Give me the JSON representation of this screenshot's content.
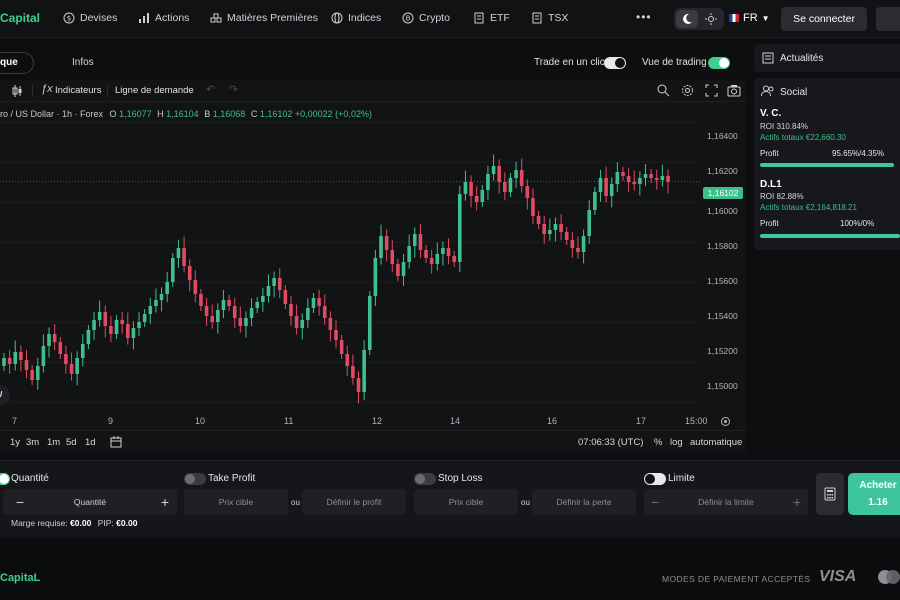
{
  "brand": {
    "name": "Capital"
  },
  "nav": {
    "items": [
      "Devises",
      "Actions",
      "Matières Premières",
      "Indices",
      "Crypto",
      "ETF",
      "TSX"
    ]
  },
  "header": {
    "lang": "FR",
    "login": "Se connecter"
  },
  "tabs": {
    "active": "que",
    "infos": "Infos"
  },
  "toggles": {
    "one_click": "Trade en un clic",
    "trading_view": "Vue de trading"
  },
  "chart": {
    "toolbar": {
      "indicators": "Indicateurs",
      "demand_line": "Ligne de demande"
    },
    "instrument": "ro / US Dollar · 1h · Forex",
    "ohlc": {
      "o_label": "O",
      "o": "1,16077",
      "h_label": "H",
      "h": "1,16104",
      "b_label": "B",
      "b": "1,16068",
      "c_label": "C",
      "c": "1,16102",
      "change": "+0,00022 (+0,02%)"
    },
    "current_price": "1,16102",
    "yticks": [
      "1,16400",
      "1,16200",
      "1,16000",
      "1,15800",
      "1,15600",
      "1,15400",
      "1,15200",
      "1,15000"
    ],
    "xticks": [
      "7",
      "9",
      "10",
      "11",
      "12",
      "14",
      "16",
      "17",
      "15:00"
    ],
    "ranges": [
      "1y",
      "3m",
      "1m",
      "5d",
      "1d"
    ],
    "time": "07:06:33 (UTC)",
    "scale": {
      "pct": "%",
      "log": "log",
      "auto": "automatique"
    }
  },
  "chart_data": {
    "type": "candlestick",
    "instrument": "ro / US Dollar · 1h · Forex",
    "ylim": [
      1.149,
      1.165
    ],
    "yticks": [
      1.164,
      1.162,
      1.16,
      1.158,
      1.156,
      1.154,
      1.152,
      1.15
    ],
    "xticks": [
      "7",
      "9",
      "10",
      "11",
      "12",
      "14",
      "16",
      "17",
      "15:00"
    ],
    "last": 1.16102,
    "closes": [
      1.1522,
      1.1519,
      1.1525,
      1.1521,
      1.1516,
      1.1511,
      1.1518,
      1.1528,
      1.1534,
      1.153,
      1.1524,
      1.1519,
      1.1514,
      1.1522,
      1.1529,
      1.1536,
      1.1541,
      1.1545,
      1.1538,
      1.1534,
      1.1541,
      1.1539,
      1.1532,
      1.1537,
      1.154,
      1.1544,
      1.1548,
      1.1551,
      1.1554,
      1.156,
      1.1572,
      1.1577,
      1.1568,
      1.1561,
      1.1554,
      1.1548,
      1.1543,
      1.154,
      1.1546,
      1.1551,
      1.1548,
      1.1542,
      1.1538,
      1.1542,
      1.1547,
      1.155,
      1.1553,
      1.1558,
      1.1562,
      1.1556,
      1.1549,
      1.1543,
      1.1537,
      1.1541,
      1.1547,
      1.1552,
      1.1548,
      1.1542,
      1.1536,
      1.1531,
      1.1524,
      1.1518,
      1.1512,
      1.1505,
      1.1526,
      1.1553,
      1.1572,
      1.1583,
      1.1576,
      1.1569,
      1.1563,
      1.157,
      1.1578,
      1.1584,
      1.1576,
      1.1572,
      1.1569,
      1.1574,
      1.1577,
      1.1573,
      1.157,
      1.1604,
      1.161,
      1.1603,
      1.16,
      1.1606,
      1.1614,
      1.1618,
      1.161,
      1.1605,
      1.1612,
      1.1616,
      1.1608,
      1.1602,
      1.1593,
      1.1589,
      1.1584,
      1.1586,
      1.1589,
      1.1585,
      1.1581,
      1.1577,
      1.1575,
      1.1583,
      1.1596,
      1.1605,
      1.1612,
      1.1603,
      1.1609,
      1.1615,
      1.1613,
      1.161,
      1.1609,
      1.1612,
      1.1614,
      1.1612,
      1.1611,
      1.1613,
      1.161
    ]
  },
  "news": {
    "title": "Actualités"
  },
  "social": {
    "title": "Social",
    "traders": [
      {
        "name": "V. C.",
        "roi": "ROI 310.84%",
        "assets": "Actifs totaux €22,660.30",
        "profit_label": "Profit",
        "profit": "95.65%/4.35%",
        "ratio": 0.9565
      },
      {
        "name": "D.L1",
        "roi": "ROI 82.88%",
        "assets": "Actifs totaux €2,164,818.21",
        "profit_label": "Profit",
        "profit": "100%/0%",
        "ratio": 1.0
      }
    ]
  },
  "order": {
    "quantity": "Quantité",
    "quantity_input": "Quantité",
    "take_profit": "Take Profit",
    "stop_loss": "Stop Loss",
    "limit": "Limite",
    "target_price": "Prix cible",
    "or": "ou",
    "set_profit": "Définir le profit",
    "set_loss": "Définir la perte",
    "set_limit": "Définir la limite",
    "margin_label": "Marge requise:",
    "margin": "€0.00",
    "pip_label": "PIP:",
    "pip": "€0.00",
    "buy": "Acheter",
    "buy_price": "1.16"
  },
  "footer": {
    "brand": "CapitaL",
    "payments": "MODES DE PAIEMENT ACCEPTÉS",
    "visa": "VISA"
  },
  "colors": {
    "up": "#3fbf8e",
    "down": "#e04b62",
    "accent": "#3fcf8e"
  }
}
